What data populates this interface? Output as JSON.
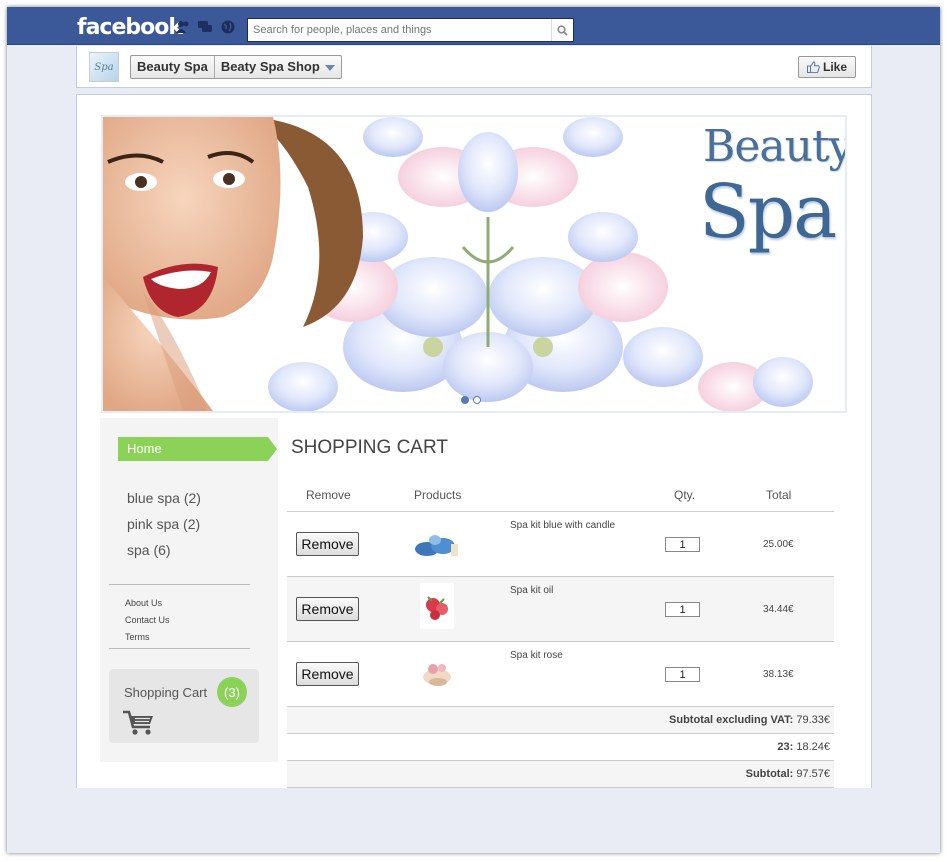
{
  "topbar": {
    "logo": "facebook",
    "search_placeholder": "Search for people, places and things",
    "icons": [
      "friends-icon",
      "messages-icon",
      "notifications-globe-icon",
      "search-icon"
    ]
  },
  "page_header": {
    "avatar_text": "Spa",
    "crumb_page": "Beauty Spa",
    "crumb_app": "Beaty Spa Shop",
    "like_label": "Like"
  },
  "banner": {
    "brand_line1": "Beauty",
    "brand_line2": "Spa",
    "slides": 2,
    "active_slide": 1
  },
  "sidebar": {
    "home_label": "Home",
    "categories": [
      {
        "label": "blue spa (2)"
      },
      {
        "label": "pink spa (2)"
      },
      {
        "label": "spa (6)"
      }
    ],
    "links": [
      {
        "label": "About Us"
      },
      {
        "label": "Contact Us"
      },
      {
        "label": "Terms"
      }
    ],
    "cart_label": "Shopping Cart",
    "cart_count": "(3)"
  },
  "cart": {
    "title": "SHOPPING CART",
    "headers": {
      "remove": "Remove",
      "products": "Products",
      "qty": "Qty.",
      "total": "Total"
    },
    "items": [
      {
        "remove_label": "Remove",
        "name": "Spa kit blue with candle",
        "qty": "1",
        "total": "25.00€"
      },
      {
        "remove_label": "Remove",
        "name": "Spa kit oil",
        "qty": "1",
        "total": "34.44€"
      },
      {
        "remove_label": "Remove",
        "name": "Spa kit rose",
        "qty": "1",
        "total": "38.13€"
      }
    ],
    "summary": [
      {
        "label": "Subtotal excluding VAT:",
        "value": " 79.33€"
      },
      {
        "label": "23:",
        "value": " 18.24€"
      },
      {
        "label": "Subtotal:",
        "value": " 97.57€"
      }
    ]
  },
  "colors": {
    "facebook_blue": "#3b5998",
    "accent_green": "#8cd158",
    "background": "#e9ecf4"
  }
}
